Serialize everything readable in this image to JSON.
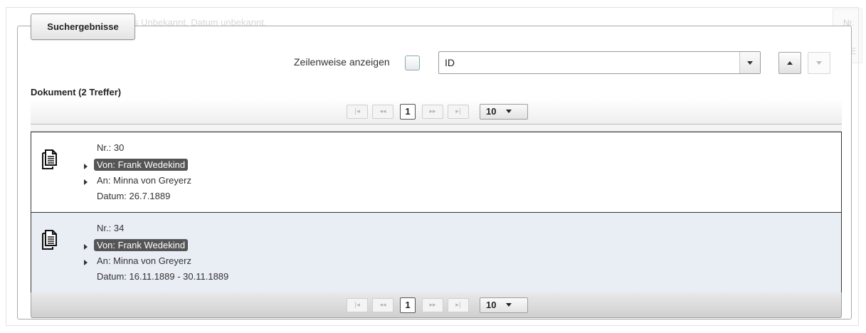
{
  "background": {
    "faded_text": "s Unbekannt. Datum unbekannt.",
    "faded_right_1": "Nr.",
    "faded_right_2": "E"
  },
  "panel": {
    "tab_label": "Suchergebnisse"
  },
  "toolbar": {
    "row_view_label": "Zeilenweise anzeigen",
    "row_view_checked": false,
    "sort_field_value": "ID",
    "sort_asc_icon": "chevron-up-icon",
    "sort_desc_icon": "chevron-down-icon"
  },
  "results": {
    "title": "Dokument (2 Treffer)",
    "items": [
      {
        "nr": "Nr.: 30",
        "from": "Von: Frank Wedekind",
        "to": "An: Minna von Greyerz",
        "date": "Datum: 26.7.1889"
      },
      {
        "nr": "Nr.: 34",
        "from": "Von: Frank Wedekind",
        "to": "An: Minna von Greyerz",
        "date": "Datum: 16.11.1889 - 30.11.1889"
      }
    ]
  },
  "pager": {
    "first": "|◂",
    "prev": "◂◂",
    "current_page": "1",
    "next": "▸▸",
    "last": "▸|",
    "page_size": "10"
  },
  "colors": {
    "highlight_bg": "#555555",
    "selected_row_bg": "#e9edf4"
  }
}
